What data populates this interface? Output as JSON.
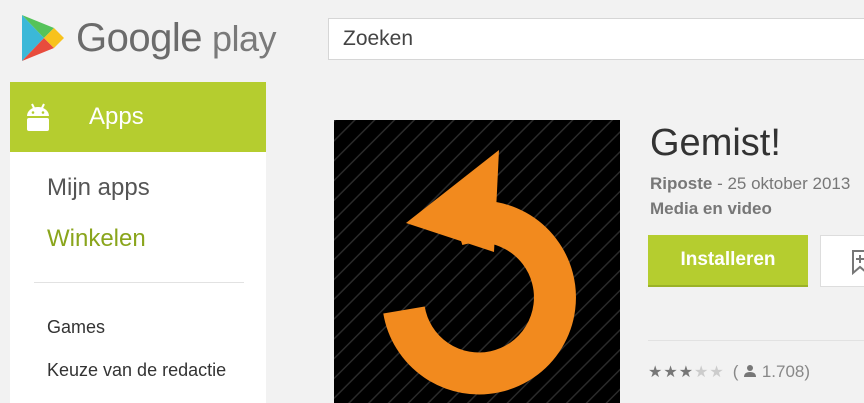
{
  "header": {
    "logo_brand": "Google",
    "logo_product": "play",
    "search_placeholder": "Zoeken"
  },
  "sidebar": {
    "active_tab_label": "Apps",
    "nav_items": [
      {
        "label": "Mijn apps",
        "active": false
      },
      {
        "label": "Winkelen",
        "active": true
      }
    ],
    "sub_items": [
      {
        "label": "Games"
      },
      {
        "label": "Keuze van de redactie"
      }
    ]
  },
  "app": {
    "title": "Gemist!",
    "developer": "Riposte",
    "date": "- 25 oktober 2013",
    "category": "Media en video",
    "install_label": "Installeren",
    "rating": {
      "stars_filled": 3,
      "stars_total": 5,
      "count": "1.708"
    }
  },
  "colors": {
    "accent_green": "#b5cd2f",
    "icon_orange": "#f28a1e"
  }
}
